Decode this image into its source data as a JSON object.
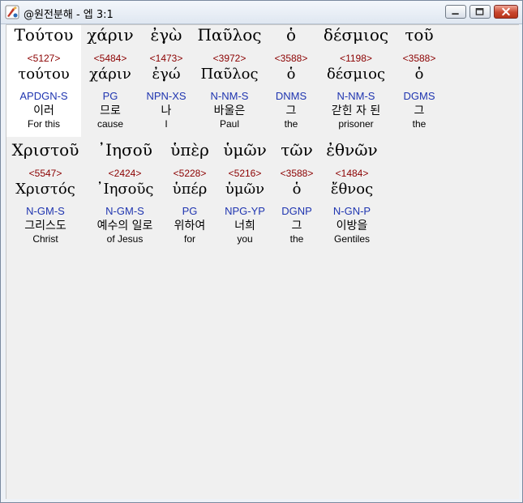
{
  "window": {
    "title": "@원전분해 - 엡 3:1"
  },
  "icons": {
    "app": "app-icon",
    "minimize": "minimize-icon",
    "maximize": "maximize-icon",
    "close": "close-icon"
  },
  "line1": [
    {
      "greek": "Τούτου",
      "strong": "<5127>",
      "lemma": "τούτου",
      "parse": "APDGN-S",
      "korean": "이러",
      "english": "For this"
    },
    {
      "greek": "χάριν",
      "strong": "<5484>",
      "lemma": "χάριν",
      "parse": "PG",
      "korean": "므로",
      "english": "cause"
    },
    {
      "greek": "ἐγὼ",
      "strong": "<1473>",
      "lemma": "ἐγώ",
      "parse": "NPN-XS",
      "korean": "나",
      "english": "I"
    },
    {
      "greek": "Παῦλος",
      "strong": "<3972>",
      "lemma": "Παῦλος",
      "parse": "N-NM-S",
      "korean": "바울은",
      "english": "Paul"
    },
    {
      "greek": "ὁ",
      "strong": "<3588>",
      "lemma": "ὁ",
      "parse": "DNMS",
      "korean": "그",
      "english": "the"
    },
    {
      "greek": "δέσμιος",
      "strong": "<1198>",
      "lemma": "δέσμιος",
      "parse": "N-NM-S",
      "korean": "갇힌 자 된",
      "english": "prisoner"
    },
    {
      "greek": "τοῦ",
      "strong": "<3588>",
      "lemma": "ὁ",
      "parse": "DGMS",
      "korean": "그",
      "english": "the"
    }
  ],
  "line2": [
    {
      "greek": "Χριστοῦ",
      "strong": "<5547>",
      "lemma": "Χριστός",
      "parse": "N-GM-S",
      "korean": "그리스도",
      "english": "Christ"
    },
    {
      "greek": "᾽Ιησοῦ",
      "strong": "<2424>",
      "lemma": "᾽Ιησοῦς",
      "parse": "N-GM-S",
      "korean": "예수의 일로",
      "english": "of Jesus"
    },
    {
      "greek": "ὑπὲρ",
      "strong": "<5228>",
      "lemma": "ὑπέρ",
      "parse": "PG",
      "korean": "위하여",
      "english": "for"
    },
    {
      "greek": "ὑμῶν",
      "strong": "<5216>",
      "lemma": "ὑμῶν",
      "parse": "NPG-YP",
      "korean": "너희",
      "english": "you"
    },
    {
      "greek": "τῶν",
      "strong": "<3588>",
      "lemma": "ὁ",
      "parse": "DGNP",
      "korean": "그",
      "english": "the"
    },
    {
      "greek": "ἐθνῶν",
      "strong": "<1484>",
      "lemma": "ἔθνος",
      "parse": "N-GN-P",
      "korean": "이방을",
      "english": "Gentiles"
    }
  ]
}
